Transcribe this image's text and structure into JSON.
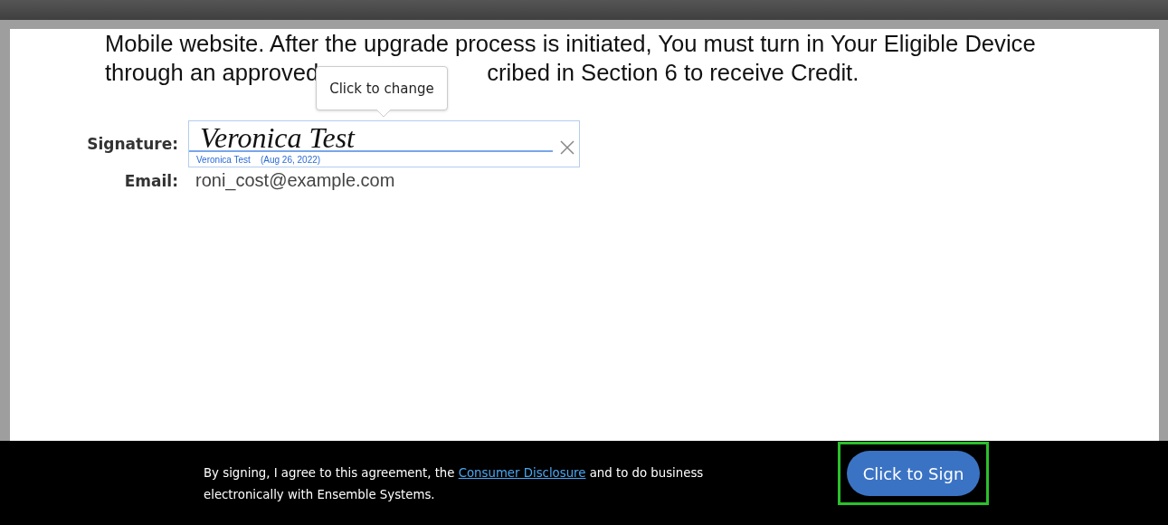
{
  "document": {
    "line_1": "Mobile website. After the upgrade process is initiated, You must turn in Your Eligible Device",
    "line_2_start": "through an approved",
    "line_2_end": "cribed in Section 6 to receive Credit."
  },
  "tooltip": {
    "text": "Click to change"
  },
  "signature": {
    "label": "Signature:",
    "value": "Veronica Test",
    "signer": "Veronica Test",
    "date": "(Aug 26, 2022)"
  },
  "email": {
    "label": "Email:",
    "value": "roni_cost@example.com"
  },
  "footer": {
    "text_before": "By signing, I agree to this agreement, the",
    "link": "Consumer Disclosure",
    "text_after": "and to do business electronically with Ensemble Systems.",
    "button": "Click to Sign",
    "highlighted": true
  }
}
